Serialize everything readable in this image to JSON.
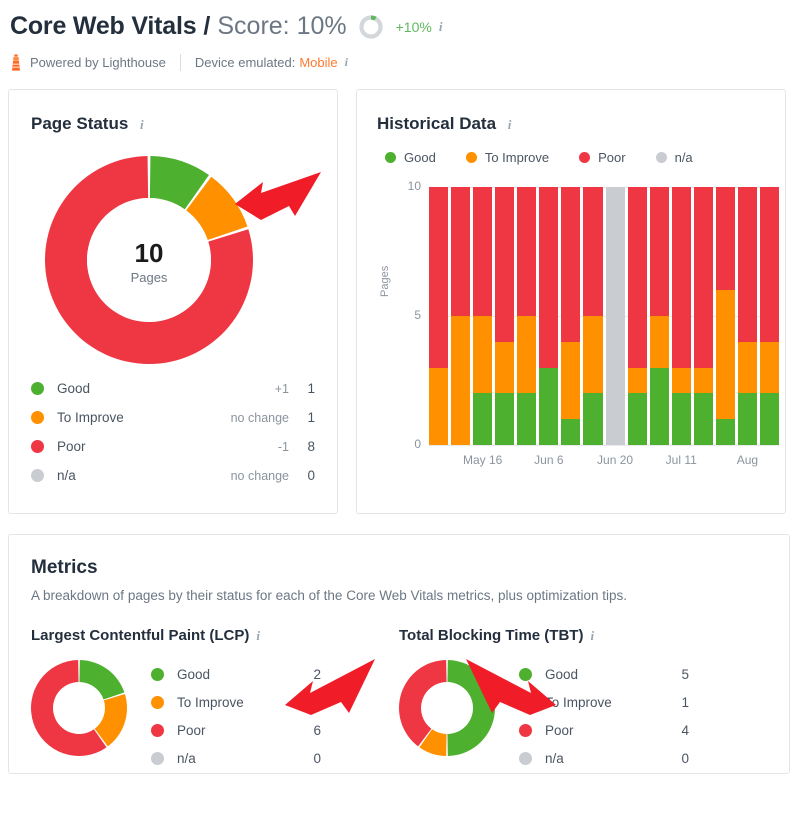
{
  "header": {
    "title": "Core Web Vitals",
    "separator": "/",
    "score_label": "Score: 10%",
    "score_ring_icon": "score-ring-icon",
    "score_delta": "+10%",
    "info_icon": "info-icon"
  },
  "subheader": {
    "lighthouse_icon": "lighthouse-icon",
    "powered_by": "Powered by Lighthouse",
    "device_label": "Device emulated:",
    "device_value": "Mobile",
    "info_icon": "info-icon"
  },
  "page_status": {
    "title": "Page Status",
    "info_icon": "info-icon",
    "center_value": "10",
    "center_label": "Pages",
    "legend": [
      {
        "label": "Good",
        "change": "+1",
        "value": "1",
        "color": "#4eb02f"
      },
      {
        "label": "To Improve",
        "change": "no change",
        "value": "1",
        "color": "#ff9000"
      },
      {
        "label": "Poor",
        "change": "-1",
        "value": "8",
        "color": "#ef3744"
      },
      {
        "label": "n/a",
        "change": "no change",
        "value": "0",
        "color": "#c9cdd1"
      }
    ]
  },
  "historical": {
    "title": "Historical Data",
    "info_icon": "info-icon",
    "legend": [
      {
        "label": "Good",
        "color": "#4eb02f"
      },
      {
        "label": "To Improve",
        "color": "#ff9000"
      },
      {
        "label": "Poor",
        "color": "#ef3744"
      },
      {
        "label": "n/a",
        "color": "#c9cdd1"
      }
    ]
  },
  "metrics": {
    "title": "Metrics",
    "subtitle": "A breakdown of pages by their status for each of the Core Web Vitals metrics, plus optimization tips.",
    "blocks": [
      {
        "name": "Largest Contentful Paint (LCP)",
        "info_icon": "info-icon",
        "legend": [
          {
            "label": "Good",
            "value": "2",
            "color": "#4eb02f"
          },
          {
            "label": "To Improve",
            "value": "2",
            "color": "#ff9000"
          },
          {
            "label": "Poor",
            "value": "6",
            "color": "#ef3744"
          },
          {
            "label": "n/a",
            "value": "0",
            "color": "#c9cdd1"
          }
        ]
      },
      {
        "name": "Total Blocking Time (TBT)",
        "info_icon": "info-icon",
        "legend": [
          {
            "label": "Good",
            "value": "5",
            "color": "#4eb02f"
          },
          {
            "label": "To Improve",
            "value": "1",
            "color": "#ff9000"
          },
          {
            "label": "Poor",
            "value": "4",
            "color": "#ef3744"
          },
          {
            "label": "n/a",
            "value": "0",
            "color": "#c9cdd1"
          }
        ]
      }
    ]
  },
  "annotations": [
    {
      "name": "red-arrow-pointing-left-at-page-status-donut"
    },
    {
      "name": "red-arrow-pointing-left-at-lcp-donut"
    },
    {
      "name": "red-arrow-pointing-right-at-tbt-donut"
    }
  ],
  "colors": {
    "good": "#4eb02f",
    "to_improve": "#ff9000",
    "poor": "#ef3744",
    "na": "#c9cdd1",
    "accent_orange": "#ff7a2f",
    "text_dark": "#242f3d",
    "text_muted": "#6c7784",
    "arrow_red": "#f01c28"
  },
  "chart_data": [
    {
      "type": "pie",
      "name": "page-status-donut",
      "title": "Page Status",
      "labels": [
        "Good",
        "To Improve",
        "Poor",
        "n/a"
      ],
      "values": [
        1,
        1,
        8,
        0
      ],
      "colors": [
        "#4eb02f",
        "#ff9000",
        "#ef3744",
        "#c9cdd1"
      ],
      "total": 10,
      "center_text": "10",
      "center_sub": "Pages",
      "start_angle": 0,
      "hole": 0.58
    },
    {
      "type": "bar",
      "name": "historical-data-stacked-bars",
      "title": "Historical Data",
      "stacked": true,
      "xlabel": "",
      "ylabel": "Pages",
      "ylim": [
        0,
        10
      ],
      "yticks": [
        0,
        5,
        10
      ],
      "grid": true,
      "legend_position": "top",
      "categories": [
        "1",
        "2",
        "3",
        "4",
        "5",
        "6",
        "7",
        "8",
        "9",
        "10",
        "11",
        "12",
        "13",
        "14",
        "15",
        "16"
      ],
      "tick_labels": [
        {
          "index": 2,
          "label": "May 16"
        },
        {
          "index": 5,
          "label": "Jun 6"
        },
        {
          "index": 8,
          "label": "Jun 20"
        },
        {
          "index": 11,
          "label": "Jul 11"
        },
        {
          "index": 14,
          "label": "Aug"
        }
      ],
      "series": [
        {
          "name": "Good",
          "color": "#4eb02f",
          "values": [
            0,
            0,
            2,
            2,
            2,
            3,
            1,
            2,
            0,
            2,
            3,
            2,
            2,
            1,
            2,
            2
          ]
        },
        {
          "name": "To Improve",
          "color": "#ff9000",
          "values": [
            3,
            5,
            3,
            2,
            3,
            0,
            3,
            3,
            0,
            1,
            2,
            1,
            1,
            5,
            2,
            2
          ]
        },
        {
          "name": "Poor",
          "color": "#ef3744",
          "values": [
            7,
            5,
            5,
            6,
            5,
            7,
            6,
            5,
            0,
            7,
            5,
            7,
            7,
            4,
            6,
            6
          ]
        },
        {
          "name": "n/a",
          "color": "#c9cdd1",
          "values": [
            0,
            0,
            0,
            0,
            0,
            0,
            0,
            0,
            10,
            0,
            0,
            0,
            0,
            0,
            0,
            0
          ]
        }
      ]
    },
    {
      "type": "pie",
      "name": "lcp-donut",
      "title": "Largest Contentful Paint (LCP)",
      "labels": [
        "Good",
        "To Improve",
        "Poor",
        "n/a"
      ],
      "values": [
        2,
        2,
        6,
        0
      ],
      "colors": [
        "#4eb02f",
        "#ff9000",
        "#ef3744",
        "#c9cdd1"
      ],
      "total": 10,
      "start_angle": 0,
      "hole": 0.55
    },
    {
      "type": "pie",
      "name": "tbt-donut",
      "title": "Total Blocking Time (TBT)",
      "labels": [
        "Good",
        "To Improve",
        "Poor",
        "n/a"
      ],
      "values": [
        5,
        1,
        4,
        0
      ],
      "colors": [
        "#4eb02f",
        "#ff9000",
        "#ef3744",
        "#c9cdd1"
      ],
      "total": 10,
      "start_angle": 0,
      "hole": 0.55
    }
  ]
}
